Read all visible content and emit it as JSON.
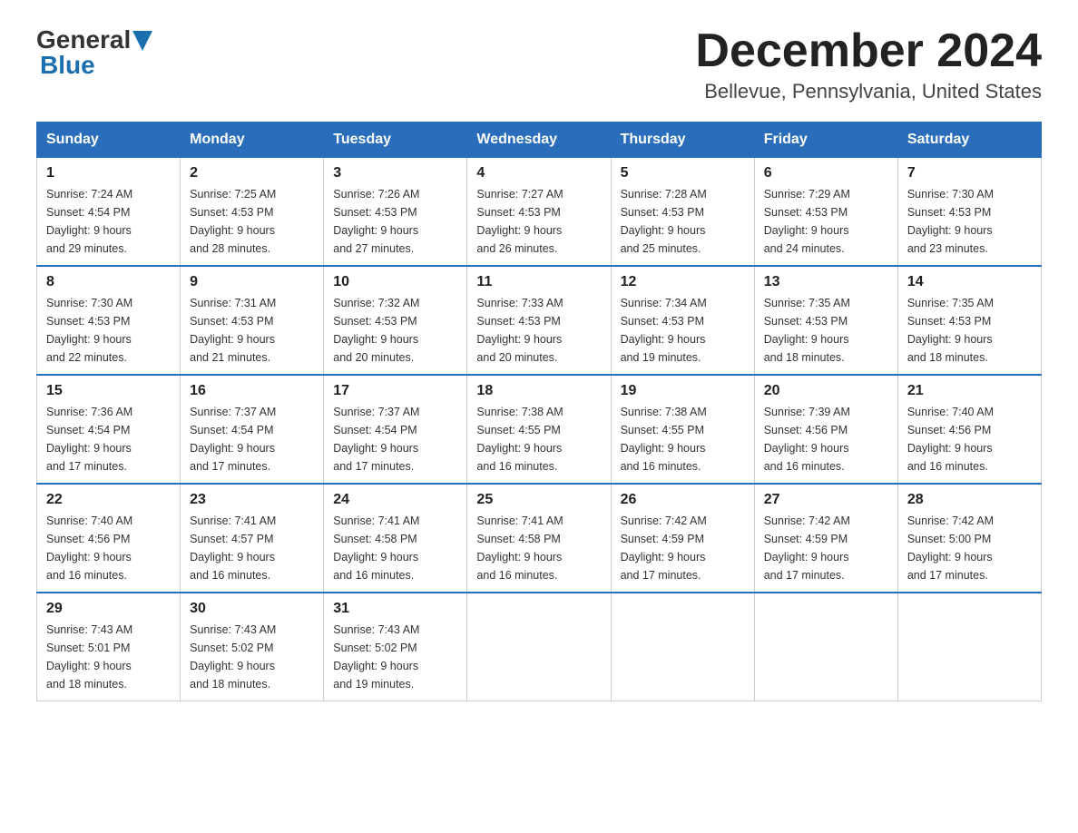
{
  "header": {
    "logo_general": "General",
    "logo_blue": "Blue",
    "month_title": "December 2024",
    "location": "Bellevue, Pennsylvania, United States"
  },
  "weekdays": [
    "Sunday",
    "Monday",
    "Tuesday",
    "Wednesday",
    "Thursday",
    "Friday",
    "Saturday"
  ],
  "weeks": [
    [
      {
        "day": "1",
        "sunrise": "7:24 AM",
        "sunset": "4:54 PM",
        "daylight": "9 hours and 29 minutes."
      },
      {
        "day": "2",
        "sunrise": "7:25 AM",
        "sunset": "4:53 PM",
        "daylight": "9 hours and 28 minutes."
      },
      {
        "day": "3",
        "sunrise": "7:26 AM",
        "sunset": "4:53 PM",
        "daylight": "9 hours and 27 minutes."
      },
      {
        "day": "4",
        "sunrise": "7:27 AM",
        "sunset": "4:53 PM",
        "daylight": "9 hours and 26 minutes."
      },
      {
        "day": "5",
        "sunrise": "7:28 AM",
        "sunset": "4:53 PM",
        "daylight": "9 hours and 25 minutes."
      },
      {
        "day": "6",
        "sunrise": "7:29 AM",
        "sunset": "4:53 PM",
        "daylight": "9 hours and 24 minutes."
      },
      {
        "day": "7",
        "sunrise": "7:30 AM",
        "sunset": "4:53 PM",
        "daylight": "9 hours and 23 minutes."
      }
    ],
    [
      {
        "day": "8",
        "sunrise": "7:30 AM",
        "sunset": "4:53 PM",
        "daylight": "9 hours and 22 minutes."
      },
      {
        "day": "9",
        "sunrise": "7:31 AM",
        "sunset": "4:53 PM",
        "daylight": "9 hours and 21 minutes."
      },
      {
        "day": "10",
        "sunrise": "7:32 AM",
        "sunset": "4:53 PM",
        "daylight": "9 hours and 20 minutes."
      },
      {
        "day": "11",
        "sunrise": "7:33 AM",
        "sunset": "4:53 PM",
        "daylight": "9 hours and 20 minutes."
      },
      {
        "day": "12",
        "sunrise": "7:34 AM",
        "sunset": "4:53 PM",
        "daylight": "9 hours and 19 minutes."
      },
      {
        "day": "13",
        "sunrise": "7:35 AM",
        "sunset": "4:53 PM",
        "daylight": "9 hours and 18 minutes."
      },
      {
        "day": "14",
        "sunrise": "7:35 AM",
        "sunset": "4:53 PM",
        "daylight": "9 hours and 18 minutes."
      }
    ],
    [
      {
        "day": "15",
        "sunrise": "7:36 AM",
        "sunset": "4:54 PM",
        "daylight": "9 hours and 17 minutes."
      },
      {
        "day": "16",
        "sunrise": "7:37 AM",
        "sunset": "4:54 PM",
        "daylight": "9 hours and 17 minutes."
      },
      {
        "day": "17",
        "sunrise": "7:37 AM",
        "sunset": "4:54 PM",
        "daylight": "9 hours and 17 minutes."
      },
      {
        "day": "18",
        "sunrise": "7:38 AM",
        "sunset": "4:55 PM",
        "daylight": "9 hours and 16 minutes."
      },
      {
        "day": "19",
        "sunrise": "7:38 AM",
        "sunset": "4:55 PM",
        "daylight": "9 hours and 16 minutes."
      },
      {
        "day": "20",
        "sunrise": "7:39 AM",
        "sunset": "4:56 PM",
        "daylight": "9 hours and 16 minutes."
      },
      {
        "day": "21",
        "sunrise": "7:40 AM",
        "sunset": "4:56 PM",
        "daylight": "9 hours and 16 minutes."
      }
    ],
    [
      {
        "day": "22",
        "sunrise": "7:40 AM",
        "sunset": "4:56 PM",
        "daylight": "9 hours and 16 minutes."
      },
      {
        "day": "23",
        "sunrise": "7:41 AM",
        "sunset": "4:57 PM",
        "daylight": "9 hours and 16 minutes."
      },
      {
        "day": "24",
        "sunrise": "7:41 AM",
        "sunset": "4:58 PM",
        "daylight": "9 hours and 16 minutes."
      },
      {
        "day": "25",
        "sunrise": "7:41 AM",
        "sunset": "4:58 PM",
        "daylight": "9 hours and 16 minutes."
      },
      {
        "day": "26",
        "sunrise": "7:42 AM",
        "sunset": "4:59 PM",
        "daylight": "9 hours and 17 minutes."
      },
      {
        "day": "27",
        "sunrise": "7:42 AM",
        "sunset": "4:59 PM",
        "daylight": "9 hours and 17 minutes."
      },
      {
        "day": "28",
        "sunrise": "7:42 AM",
        "sunset": "5:00 PM",
        "daylight": "9 hours and 17 minutes."
      }
    ],
    [
      {
        "day": "29",
        "sunrise": "7:43 AM",
        "sunset": "5:01 PM",
        "daylight": "9 hours and 18 minutes."
      },
      {
        "day": "30",
        "sunrise": "7:43 AM",
        "sunset": "5:02 PM",
        "daylight": "9 hours and 18 minutes."
      },
      {
        "day": "31",
        "sunrise": "7:43 AM",
        "sunset": "5:02 PM",
        "daylight": "9 hours and 19 minutes."
      },
      null,
      null,
      null,
      null
    ]
  ],
  "labels": {
    "sunrise": "Sunrise:",
    "sunset": "Sunset:",
    "daylight": "Daylight:"
  }
}
